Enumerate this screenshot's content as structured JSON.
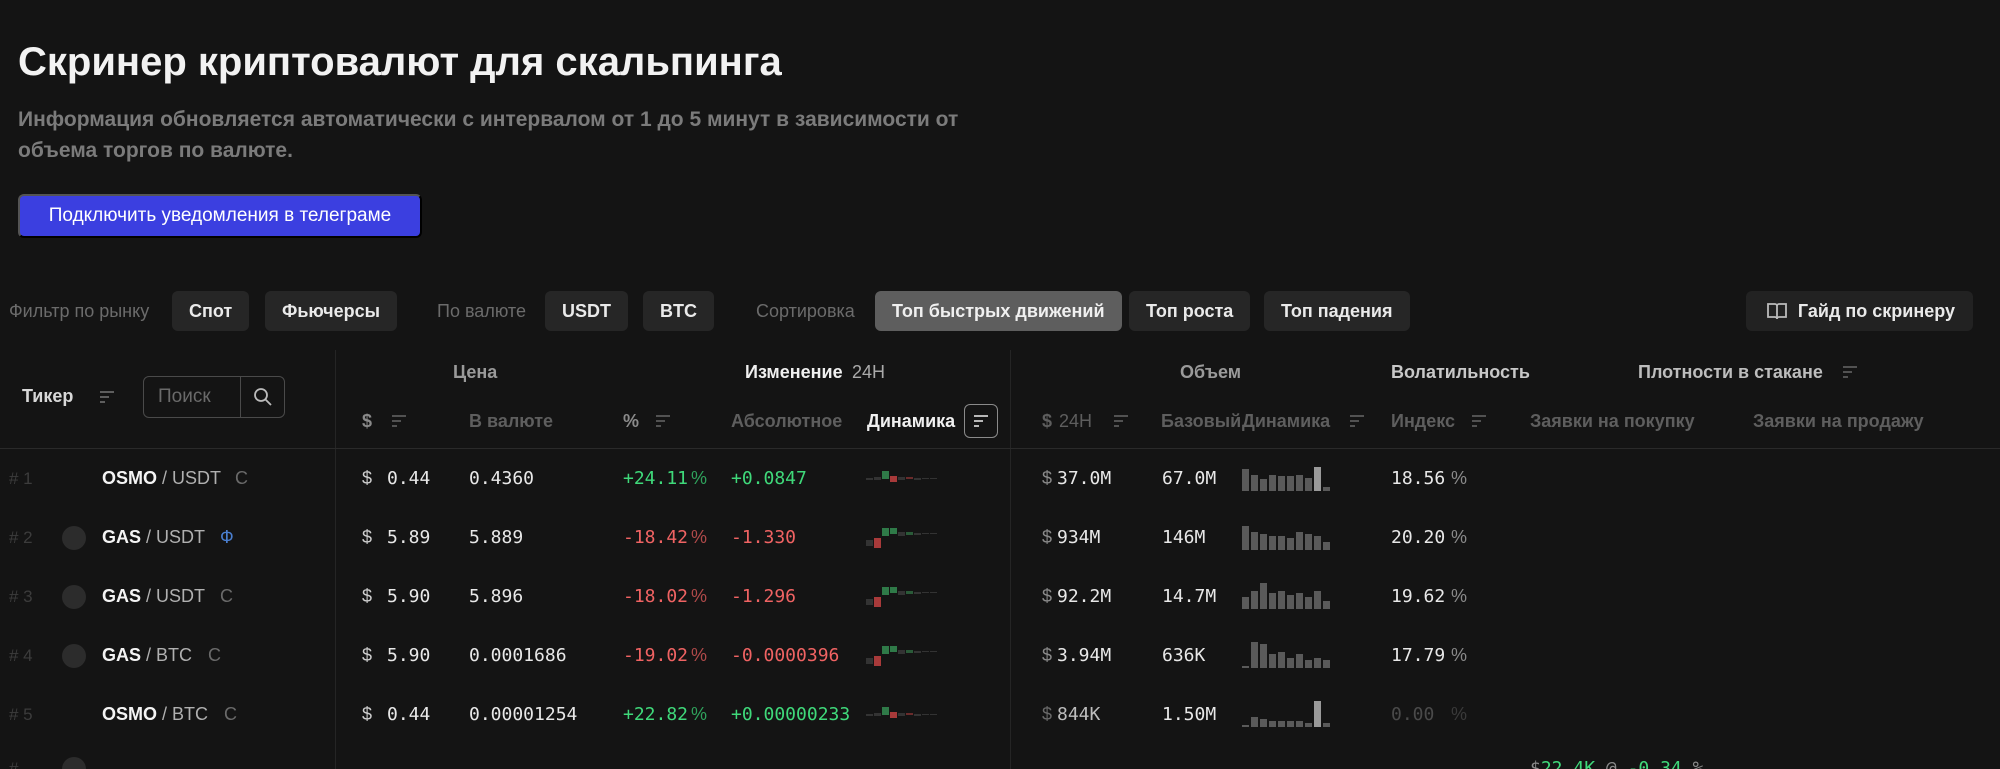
{
  "page": {
    "title": "Скринер криптовалют для скальпинга",
    "subtitle": "Информация обновляется автоматически с интервалом от 1 до 5 минут в зависимости от объема торгов по валюте.",
    "telegram_button": "Подключить уведомления в телеграме"
  },
  "filters": {
    "market_label": "Фильтр по рынку",
    "market_options": [
      "Спот",
      "Фьючерсы"
    ],
    "currency_label": "По валюте",
    "currency_options": [
      "USDT",
      "BTC"
    ],
    "sort_label": "Сортировка",
    "sort_options": [
      "Топ быстрых движений",
      "Топ роста",
      "Топ падения"
    ],
    "sort_active": "Топ быстрых движений",
    "guide_button": "Гайд по скринеру"
  },
  "table": {
    "groups": {
      "ticker": "Тикер",
      "price": "Цена",
      "change": "Изменение",
      "change_period": "24Н",
      "volume": "Объем",
      "volatility": "Волатильность",
      "orderbook": "Плотности в стакане"
    },
    "search_placeholder": "Поиск",
    "subheaders": {
      "price_usd": "$",
      "price_quote": "В валюте",
      "change_pct": "%",
      "change_abs": "Абсолютное",
      "change_dyn": "Динамика",
      "vol_usd": "$",
      "vol_period": "24Н",
      "vol_base": "Базовый",
      "vol_dyn": "Динамика",
      "vol_index": "Индекс",
      "bids": "Заявки на покупку",
      "asks": "Заявки на продажу"
    },
    "rows": [
      {
        "rank": "# 1",
        "base": "OSMO",
        "quote": "/ USDT",
        "market": "С",
        "usd": "0.44",
        "price": "0.4360",
        "pct": "+24.11",
        "abs": "+0.0847",
        "vol_usd": "37.0M",
        "vol_base": "67.0M",
        "index": "18.56",
        "trend": "pos"
      },
      {
        "rank": "# 2",
        "base": "GAS",
        "quote": "/ USDT",
        "market": "Ф",
        "usd": "5.89",
        "price": "5.889",
        "pct": "-18.42",
        "abs": "-1.330",
        "vol_usd": "934M",
        "vol_base": "146M",
        "index": "20.20",
        "trend": "neg"
      },
      {
        "rank": "# 3",
        "base": "GAS",
        "quote": "/ USDT",
        "market": "С",
        "usd": "5.90",
        "price": "5.896",
        "pct": "-18.02",
        "abs": "-1.296",
        "vol_usd": "92.2M",
        "vol_base": "14.7M",
        "index": "19.62",
        "trend": "neg"
      },
      {
        "rank": "# 4",
        "base": "GAS",
        "quote": "/ BTC",
        "market": "С",
        "usd": "5.90",
        "price": "0.0001686",
        "pct": "-19.02",
        "abs": "-0.0000396",
        "vol_usd": "3.94M",
        "vol_base": "636K",
        "index": "17.79",
        "trend": "neg"
      },
      {
        "rank": "# 5",
        "base": "OSMO",
        "quote": "/ BTC",
        "market": "С",
        "usd": "0.44",
        "price": "0.00001254",
        "pct": "+22.82",
        "abs": "+0.00000233",
        "vol_usd": "844K",
        "vol_base": "1.50M",
        "index": "0.00",
        "trend": "pos"
      }
    ],
    "partial_row": {
      "bid_usd": "22.4K",
      "bid_at": "@",
      "bid_pct": "-0.34",
      "bid_unit": "%"
    },
    "units": {
      "dollar": "$",
      "percent": "%"
    }
  },
  "colors": {
    "accent": "#3b3fe0",
    "positive": "#3fd97a",
    "negative": "#f06363",
    "background": "#141414"
  }
}
